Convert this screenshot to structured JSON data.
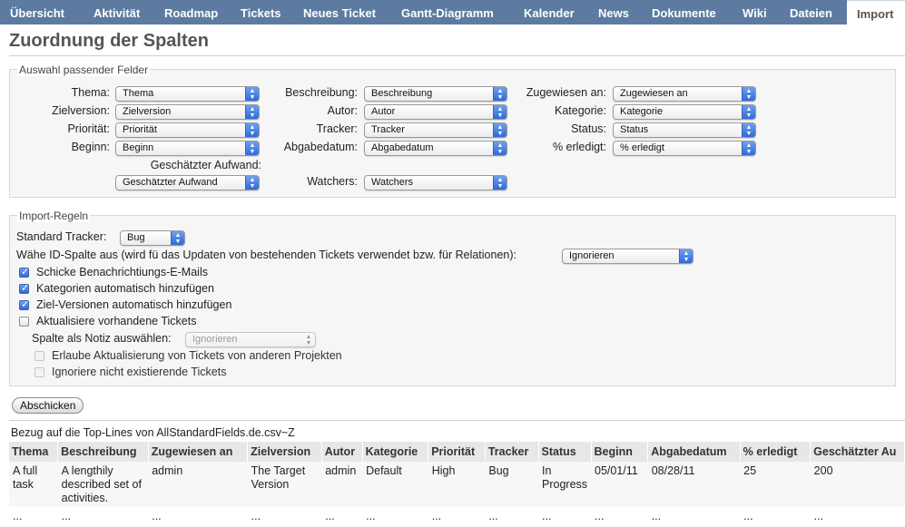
{
  "tabs": [
    {
      "label": "Übersicht"
    },
    {
      "label": "Aktivität"
    },
    {
      "label": "Roadmap"
    },
    {
      "label": "Tickets"
    },
    {
      "label": "Neues Ticket"
    },
    {
      "label": "Gantt-Diagramm"
    },
    {
      "label": "Kalender"
    },
    {
      "label": "News"
    },
    {
      "label": "Dokumente"
    },
    {
      "label": "Wiki"
    },
    {
      "label": "Dateien"
    },
    {
      "label": "Import"
    }
  ],
  "page_title": "Zuordnung der Spalten",
  "fields_section": {
    "legend": "Auswahl passender Felder",
    "rows": [
      {
        "label": "Thema:",
        "value": "Thema"
      },
      {
        "label": "Zielversion:",
        "value": "Zielversion"
      },
      {
        "label": "Priorität:",
        "value": "Priorität"
      },
      {
        "label": "Beginn:",
        "value": "Beginn"
      },
      {
        "label": "Beschreibung:",
        "value": "Beschreibung"
      },
      {
        "label": "Autor:",
        "value": "Autor"
      },
      {
        "label": "Tracker:",
        "value": "Tracker"
      },
      {
        "label": "Abgabedatum:",
        "value": "Abgabedatum"
      },
      {
        "label": "Zugewiesen an:",
        "value": "Zugewiesen an"
      },
      {
        "label": "Kategorie:",
        "value": "Kategorie"
      },
      {
        "label": "Status:",
        "value": "Status"
      },
      {
        "label": "% erledigt:",
        "value": "% erledigt"
      }
    ],
    "estimated": {
      "label": "Geschätzter Aufwand:",
      "value": "Geschätzter Aufwand"
    },
    "watchers": {
      "label": "Watchers:",
      "value": "Watchers"
    }
  },
  "rules_section": {
    "legend": "Import-Regeln",
    "default_tracker": {
      "label": "Standard Tracker:",
      "value": "Bug"
    },
    "id_column": {
      "label": "Wähe ID-Spalte aus (wird fü das Updaten von bestehenden Tickets verwendet bzw. für Relationen):",
      "value": "Ignorieren"
    },
    "checkboxes": [
      {
        "label": "Schicke Benachrichtiungs-E-Mails",
        "checked": true
      },
      {
        "label": "Kategorien automatisch hinzufügen",
        "checked": true
      },
      {
        "label": "Ziel-Versionen automatisch hinzufügen",
        "checked": true
      },
      {
        "label": "Aktualisiere vorhandene Tickets",
        "checked": false
      }
    ],
    "note_column": {
      "label": "Spalte als Notiz auswählen:",
      "value": "Ignorieren"
    },
    "sub_checkboxes": [
      {
        "label": "Erlaube Aktualisierung von Tickets von anderen Projekten",
        "checked": false
      },
      {
        "label": "Ignoriere nicht existierende Tickets",
        "checked": false
      }
    ]
  },
  "submit_label": "Abschicken",
  "preview": {
    "caption": "Bezug auf die Top-Lines von AllStandardFields.de.csv~Z",
    "headers": [
      "Thema",
      "Beschreibung",
      "Zugewiesen an",
      "Zielversion",
      "Autor",
      "Kategorie",
      "Priorität",
      "Tracker",
      "Status",
      "Beginn",
      "Abgabedatum",
      "% erledigt",
      "Geschätzter Au"
    ],
    "rows": [
      [
        "A full task",
        "A lengthily described set of activities.",
        "admin",
        "The Target Version",
        "admin",
        "Default",
        "High",
        "Bug",
        "In Progress",
        "05/01/11",
        "08/28/11",
        "25",
        "200"
      ],
      [
        "...",
        "...",
        "...",
        "...",
        "...",
        "...",
        "...",
        "...",
        "...",
        "...",
        "...",
        "...",
        "..."
      ]
    ]
  },
  "colors": {
    "tab_bar": "#5d7ba0",
    "select_arrow": "#2f6ad8",
    "fieldset_bg": "#f6f6f6"
  }
}
